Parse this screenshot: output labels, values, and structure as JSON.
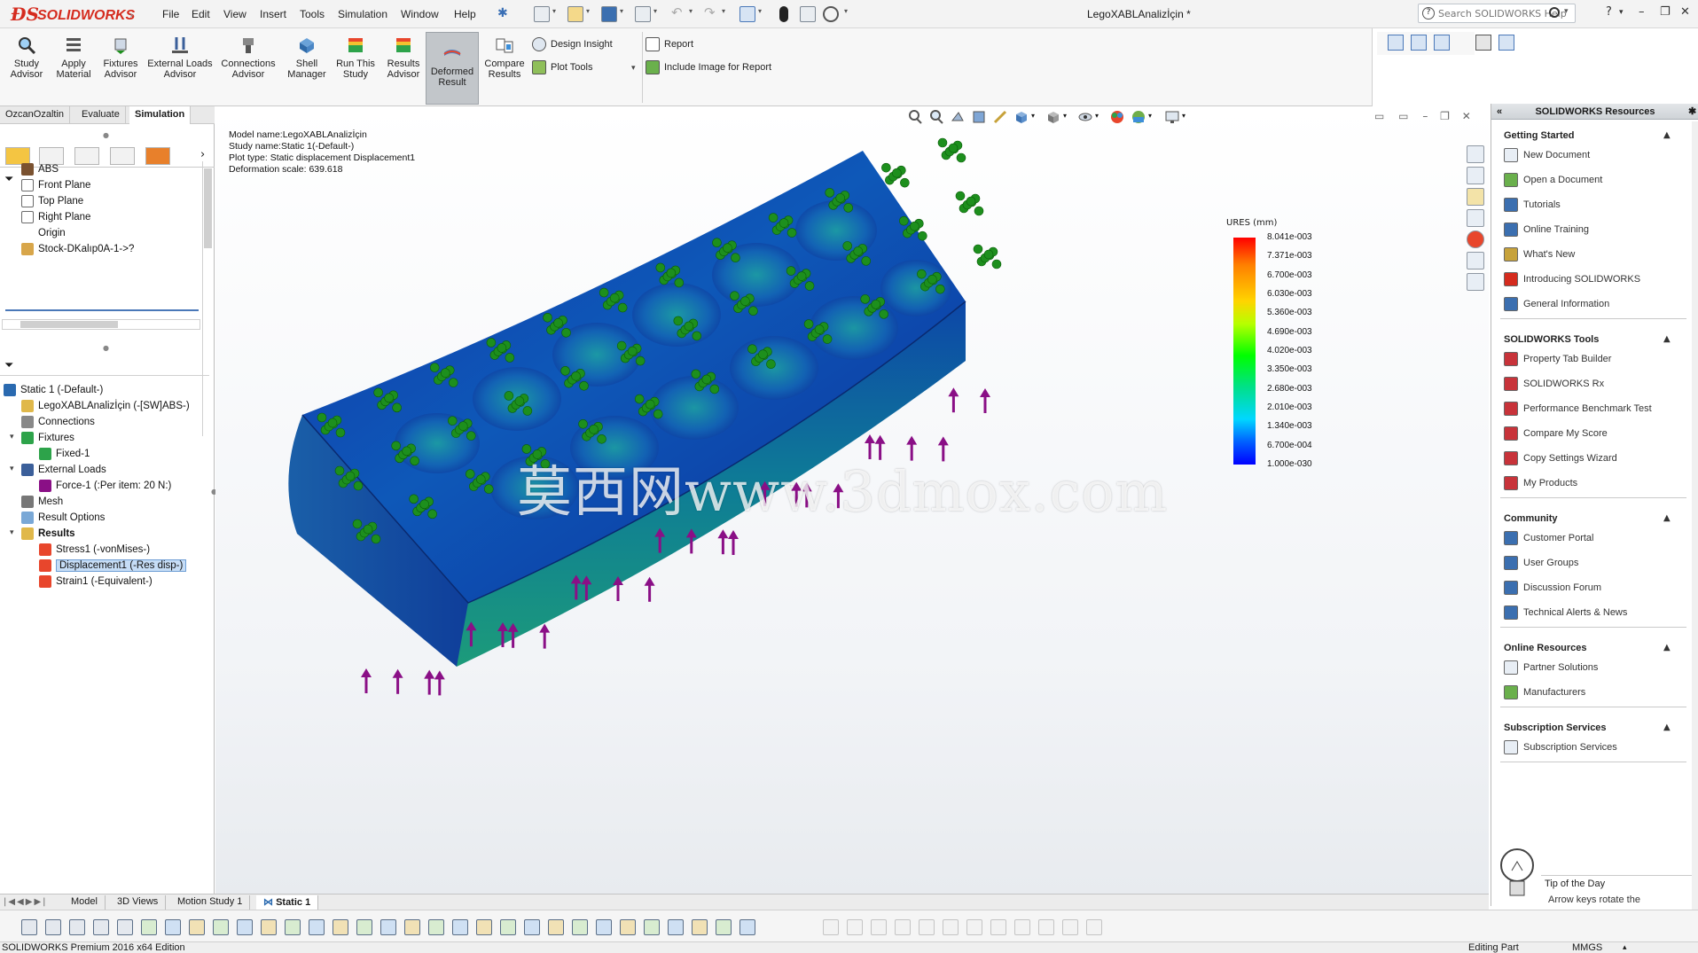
{
  "app": {
    "logo_text": "SOLIDWORKS",
    "document_title": "LegoXABLAnalizİçin *",
    "search_placeholder": "Search SOLIDWORKS Help"
  },
  "menu": [
    "File",
    "Edit",
    "View",
    "Insert",
    "Tools",
    "Simulation",
    "Window",
    "Help"
  ],
  "ribbon": {
    "buttons": [
      {
        "label": "Study\nAdvisor",
        "icon": "study-advisor-icon"
      },
      {
        "label": "Apply\nMaterial",
        "icon": "apply-material-icon"
      },
      {
        "label": "Fixtures\nAdvisor",
        "icon": "fixtures-advisor-icon"
      },
      {
        "label": "External Loads\nAdvisor",
        "icon": "external-loads-icon"
      },
      {
        "label": "Connections\nAdvisor",
        "icon": "connections-icon"
      },
      {
        "label": "Shell\nManager",
        "icon": "shell-manager-icon"
      },
      {
        "label": "Run This\nStudy",
        "icon": "run-study-icon"
      },
      {
        "label": "Results\nAdvisor",
        "icon": "results-advisor-icon"
      },
      {
        "label": "Deformed\nResult",
        "icon": "deformed-result-icon"
      },
      {
        "label": "Compare\nResults",
        "icon": "compare-results-icon"
      }
    ],
    "design_insight": "Design Insight",
    "plot_tools": "Plot Tools",
    "report": "Report",
    "include_image": "Include Image for Report"
  },
  "command_tabs": [
    "OzcanOzaltin",
    "Evaluate",
    "Simulation"
  ],
  "feature_tree": [
    {
      "label": "ABS",
      "icon": "material-icon"
    },
    {
      "label": "Front Plane",
      "icon": "plane-icon"
    },
    {
      "label": "Top Plane",
      "icon": "plane-icon"
    },
    {
      "label": "Right Plane",
      "icon": "plane-icon"
    },
    {
      "label": "Origin",
      "icon": "origin-icon"
    },
    {
      "label": "Stock-DKalıp0A-1->?",
      "icon": "stock-icon"
    }
  ],
  "study_tree": [
    {
      "label": "Static 1 (-Default-)",
      "icon": "study-icon",
      "level": 0,
      "expand": ""
    },
    {
      "label": "LegoXABLAnalizİçin (-[SW]ABS-)",
      "icon": "part-icon",
      "level": 1,
      "expand": ""
    },
    {
      "label": "Connections",
      "icon": "connections-icon",
      "level": 1,
      "expand": ""
    },
    {
      "label": "Fixtures",
      "icon": "fixtures-icon",
      "level": 1,
      "expand": "▾"
    },
    {
      "label": "Fixed-1",
      "icon": "fixed-icon",
      "level": 2,
      "expand": ""
    },
    {
      "label": "External Loads",
      "icon": "external-loads-icon",
      "level": 1,
      "expand": "▾"
    },
    {
      "label": "Force-1 (:Per item: 20 N:)",
      "icon": "force-icon",
      "level": 2,
      "expand": ""
    },
    {
      "label": "Mesh",
      "icon": "mesh-icon",
      "level": 1,
      "expand": ""
    },
    {
      "label": "Result Options",
      "icon": "result-options-icon",
      "level": 1,
      "expand": ""
    },
    {
      "label": "Results",
      "icon": "results-folder-icon",
      "level": 1,
      "expand": "▾",
      "bold": true
    },
    {
      "label": "Stress1 (-vonMises-)",
      "icon": "plot-icon",
      "level": 2,
      "expand": ""
    },
    {
      "label": "Displacement1 (-Res disp-)",
      "icon": "plot-icon",
      "level": 2,
      "expand": "",
      "selected": true
    },
    {
      "label": "Strain1 (-Equivalent-)",
      "icon": "plot-icon",
      "level": 2,
      "expand": ""
    }
  ],
  "plot_info": {
    "model_name": "Model name:LegoXABLAnalizİçin",
    "study_name": "Study name:Static 1(-Default-)",
    "plot_type": "Plot type: Static displacement Displacement1",
    "deformation_scale": "Deformation scale: 639.618"
  },
  "legend": {
    "title": "URES (mm)",
    "labels": [
      "8.041e-003",
      "7.371e-003",
      "6.700e-003",
      "6.030e-003",
      "5.360e-003",
      "4.690e-003",
      "4.020e-003",
      "3.350e-003",
      "2.680e-003",
      "2.010e-003",
      "1.340e-003",
      "6.700e-004",
      "1.000e-030"
    ]
  },
  "watermark": "莫西网www.3dmox.com",
  "task_pane": {
    "title": "SOLIDWORKS Resources",
    "sections": [
      {
        "title": "Getting Started",
        "items": [
          "New Document",
          "Open a Document",
          "Tutorials",
          "Online Training",
          "What's New",
          "Introducing SOLIDWORKS",
          "General Information"
        ]
      },
      {
        "title": "SOLIDWORKS Tools",
        "items": [
          "Property Tab Builder",
          "SOLIDWORKS Rx",
          "Performance Benchmark Test",
          "Compare My Score",
          "Copy Settings Wizard",
          "My Products"
        ]
      },
      {
        "title": "Community",
        "items": [
          "Customer Portal",
          "User Groups",
          "Discussion Forum",
          "Technical Alerts & News"
        ]
      },
      {
        "title": "Online Resources",
        "items": [
          "Partner Solutions",
          "Manufacturers"
        ]
      },
      {
        "title": "Subscription Services",
        "items": [
          "Subscription Services"
        ]
      }
    ],
    "tip_title": "Tip of the Day",
    "tip_text": "Arrow keys rotate the"
  },
  "bottom_tabs": [
    "Model",
    "3D Views",
    "Motion Study 1",
    "Static 1"
  ],
  "status": {
    "edition": "SOLIDWORKS Premium 2016 x64 Edition",
    "mode": "Editing Part",
    "units": "MMGS"
  },
  "colors": {
    "brand": "#d52b1e",
    "fixture_green": "#1d8f1d",
    "load_purple": "#8a0f86"
  }
}
